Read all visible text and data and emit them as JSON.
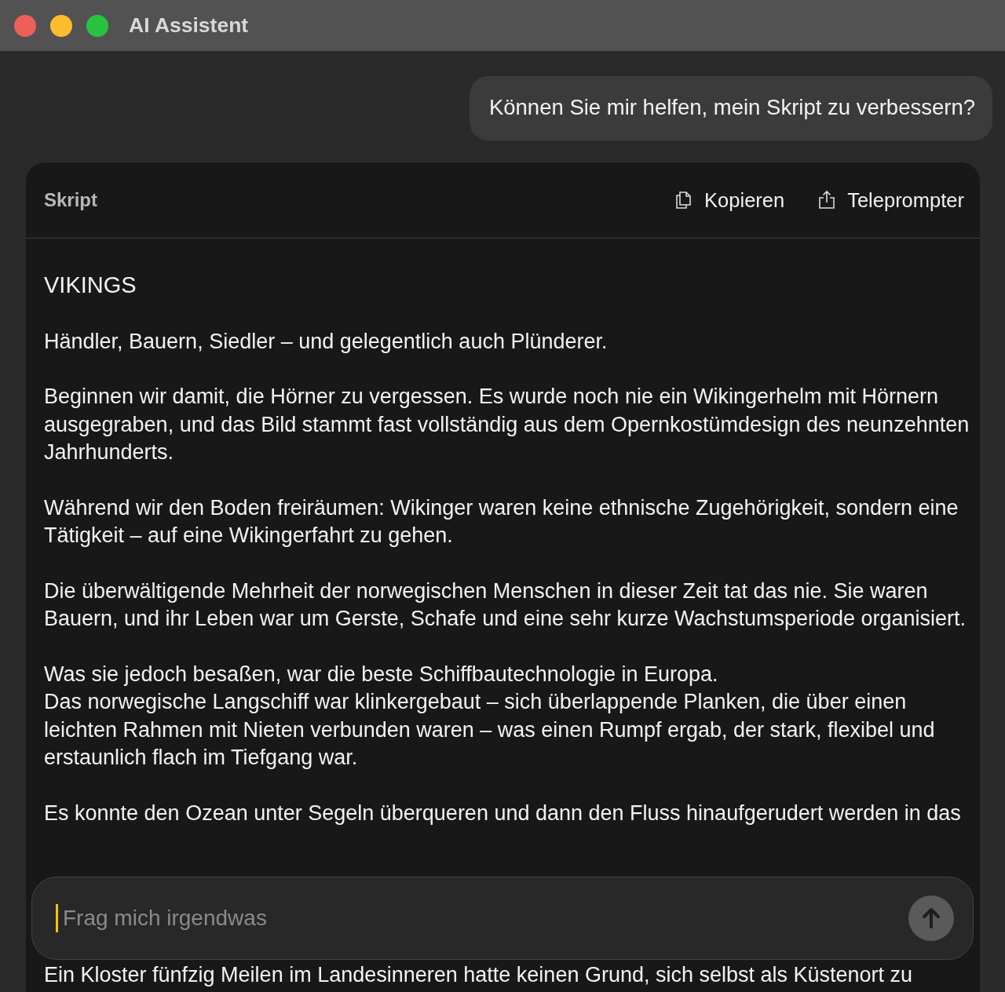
{
  "window": {
    "title": "AI Assistent"
  },
  "user_message": "Können Sie mir helfen, mein Skript zu verbessern?",
  "script_card": {
    "title": "Skript",
    "actions": [
      {
        "kind": "copy",
        "label": "Kopieren"
      },
      {
        "kind": "share",
        "label": "Teleprompter"
      }
    ],
    "heading": "VIKINGS",
    "paragraphs": [
      [
        "Händler, Bauern, Siedler – und gelegentlich auch Plünderer."
      ],
      [
        "Beginnen wir damit, die Hörner zu vergessen. Es wurde noch nie ein Wikingerhelm mit Hörnern ausgegraben, und das Bild stammt fast vollständig aus dem Opernkostümdesign des neunzehnten Jahrhunderts."
      ],
      [
        "Während wir den Boden freiräumen: Wikinger waren keine ethnische Zugehörigkeit, sondern eine Tätigkeit – auf eine Wikingerfahrt zu gehen."
      ],
      [
        "Die überwältigende Mehrheit der norwegischen Menschen in dieser Zeit tat das nie. Sie waren Bauern, und ihr Leben war um Gerste, Schafe und eine sehr kurze Wachstumsperiode organisiert."
      ],
      [
        "Was sie jedoch besaßen, war die beste Schiffbautechnologie in Europa.",
        "Das norwegische Langschiff war klinkergebaut – sich überlappende Planken, die über einen leichten Rahmen mit Nieten verbunden waren – was einen Rumpf ergab, der stark, flexibel und erstaunlich flach im Tiefgang war."
      ],
      [
        "Es konnte den Ozean unter Segeln überqueren und dann den Fluss hinaufgerudert werden in das"
      ]
    ],
    "after_input": "Ein Kloster fünfzig Meilen im Landesinneren hatte keinen Grund, sich selbst als Küstenort zu"
  },
  "composer": {
    "placeholder": "Frag mich irgendwas"
  }
}
